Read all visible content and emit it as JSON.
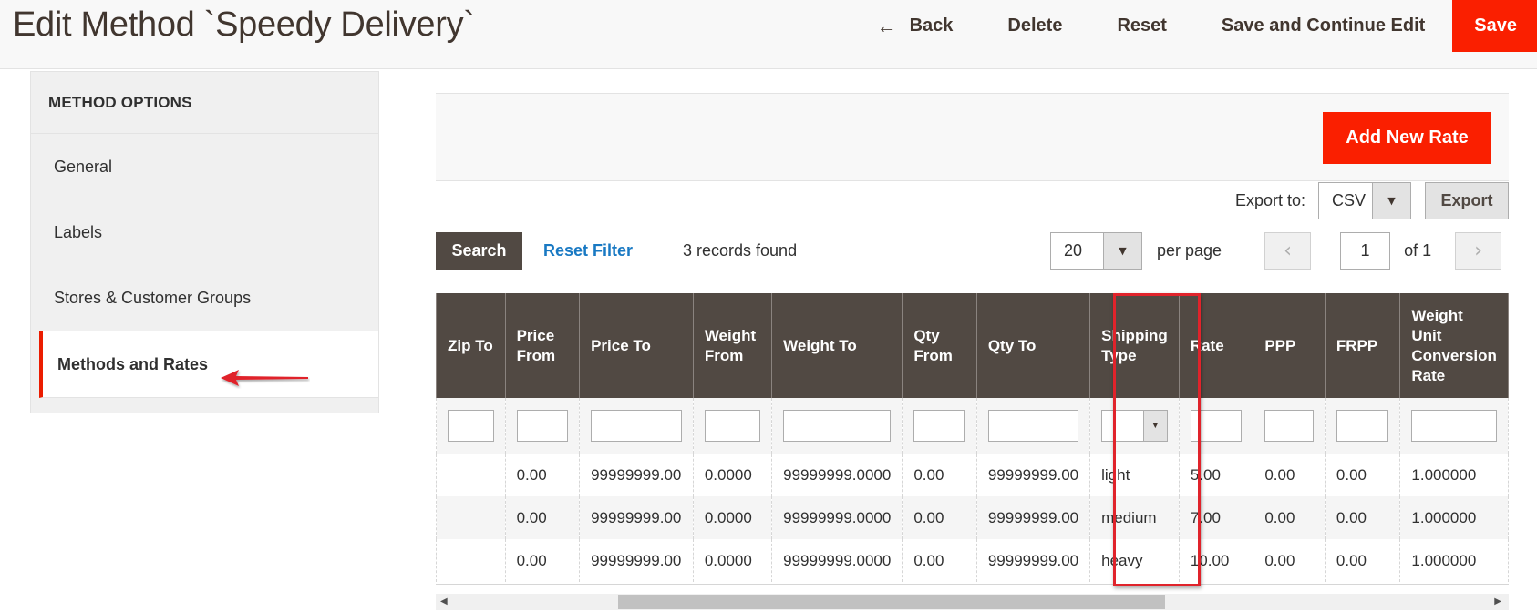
{
  "header": {
    "title": "Edit Method `Speedy Delivery`",
    "actions": {
      "back": "Back",
      "delete": "Delete",
      "reset": "Reset",
      "save_continue": "Save and Continue Edit",
      "save": "Save"
    }
  },
  "sidebar": {
    "title": "METHOD OPTIONS",
    "items": [
      {
        "label": "General"
      },
      {
        "label": "Labels"
      },
      {
        "label": "Stores & Customer Groups"
      },
      {
        "label": "Methods and Rates",
        "active": true
      }
    ]
  },
  "toolbar": {
    "add_rate": "Add New Rate",
    "export_label": "Export to:",
    "export_format": "CSV",
    "export_button": "Export",
    "search_button": "Search",
    "reset_filter": "Reset Filter",
    "records_found": "3 records found",
    "per_page_value": "20",
    "per_page_label": "per page",
    "page_current": "1",
    "page_of": "of 1",
    "prev_glyph": "‹",
    "next_glyph": "›"
  },
  "grid": {
    "columns": [
      {
        "label": "Zip To"
      },
      {
        "label": "Price From"
      },
      {
        "label": "Price To"
      },
      {
        "label": "Weight From"
      },
      {
        "label": "Weight To"
      },
      {
        "label": "Qty From"
      },
      {
        "label": "Qty To"
      },
      {
        "label": "Shipping Type"
      },
      {
        "label": "Rate"
      },
      {
        "label": "PPP"
      },
      {
        "label": "FRPP"
      },
      {
        "label": "Weight Unit Conversion Rate"
      }
    ],
    "rows": [
      [
        "",
        "0.00",
        "99999999.00",
        "0.0000",
        "99999999.0000",
        "0.00",
        "99999999.00",
        "light",
        "5.00",
        "0.00",
        "0.00",
        "1.000000"
      ],
      [
        "",
        "0.00",
        "99999999.00",
        "0.0000",
        "99999999.0000",
        "0.00",
        "99999999.00",
        "medium",
        "7.00",
        "0.00",
        "0.00",
        "1.000000"
      ],
      [
        "",
        "0.00",
        "99999999.00",
        "0.0000",
        "99999999.0000",
        "0.00",
        "99999999.00",
        "heavy",
        "10.00",
        "0.00",
        "0.00",
        "1.000000"
      ]
    ]
  },
  "colors": {
    "accent": "#fa1f00",
    "grid_header": "#514943",
    "link": "#1979c3",
    "annotation": "#e0232b"
  },
  "icons": {
    "back": "arrow-left-icon",
    "caret": "caret-down-icon",
    "annotation_arrow": "annotation-arrow-icon"
  }
}
